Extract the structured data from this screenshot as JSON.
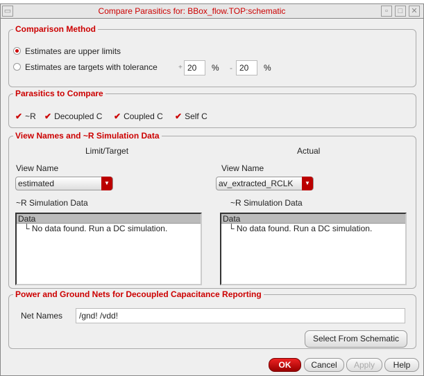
{
  "window": {
    "title": "Compare Parasitics for:  BBox_flow.TOP:schematic"
  },
  "comparison": {
    "legend": "Comparison Method",
    "opt1": "Estimates are upper limits",
    "opt2": "Estimates are targets with tolerance",
    "plus": "+",
    "minus": "-",
    "plus_value": "20",
    "minus_value": "20",
    "pct": "%"
  },
  "parasitics": {
    "legend": "Parasitics to Compare",
    "items": [
      {
        "label": "~R",
        "checked": true
      },
      {
        "label": "Decoupled C",
        "checked": true
      },
      {
        "label": "Coupled C",
        "checked": true
      },
      {
        "label": "Self C",
        "checked": true
      }
    ]
  },
  "views": {
    "legend": "View Names and ~R Simulation Data",
    "left": {
      "heading": "Limit/Target",
      "view_label": "View Name",
      "view_value": "estimated",
      "sim_label": "~R Simulation Data",
      "col": "Data",
      "row": "No data found. Run a DC simulation."
    },
    "right": {
      "heading": "Actual",
      "view_label": "View Name",
      "view_value": "av_extracted_RCLK",
      "sim_label": "~R Simulation Data",
      "col": "Data",
      "row": "No data found. Run a DC simulation."
    }
  },
  "nets": {
    "legend": "Power and Ground Nets for Decoupled Capacitance Reporting",
    "label": "Net Names",
    "value": "/gnd! /vdd!",
    "select_btn": "Select From Schematic"
  },
  "buttons": {
    "ok": "OK",
    "cancel": "Cancel",
    "apply": "Apply",
    "help": "Help"
  }
}
